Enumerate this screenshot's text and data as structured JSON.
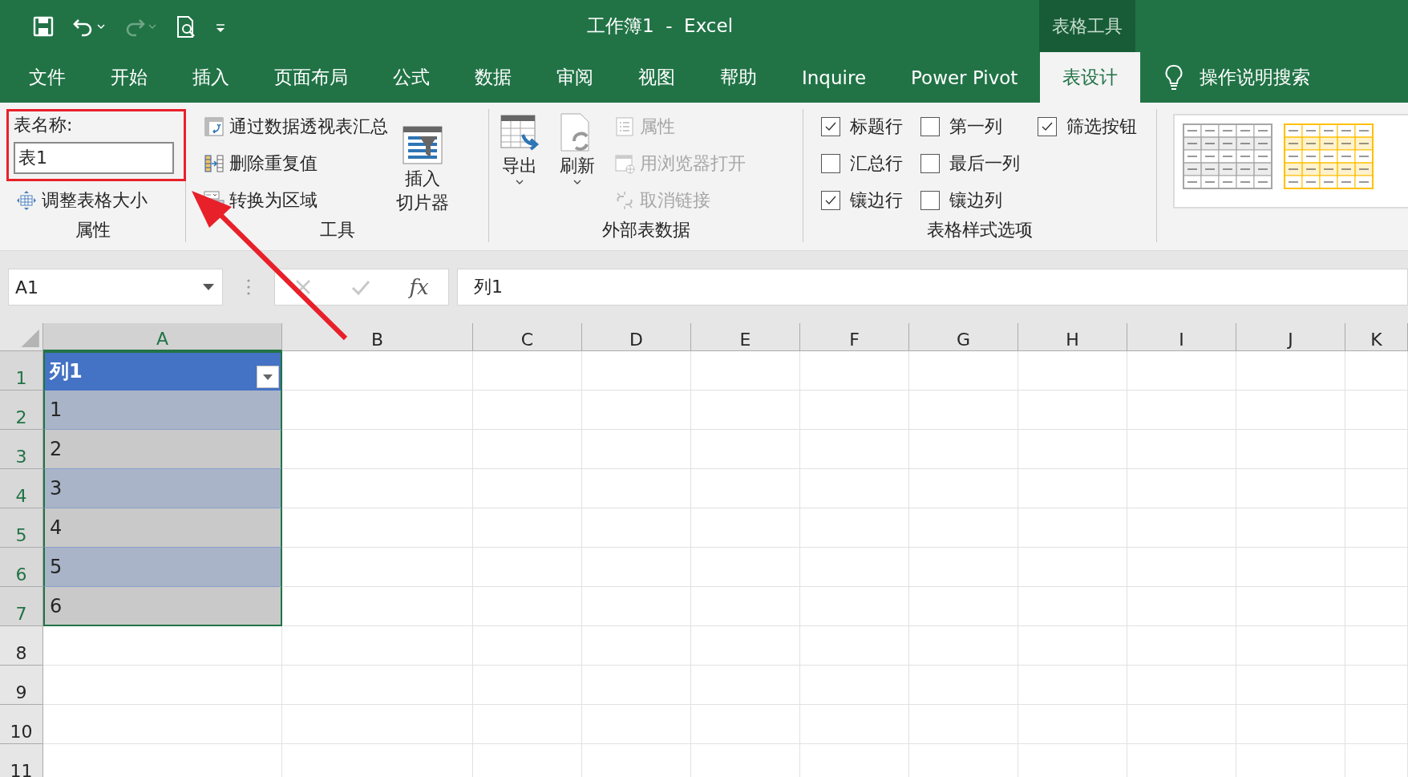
{
  "quick_access": [
    {
      "kind": "save",
      "disabled": false
    },
    {
      "kind": "undo",
      "disabled": false
    },
    {
      "kind": "redo",
      "disabled": true
    },
    {
      "kind": "preview",
      "disabled": false
    },
    {
      "kind": "customize",
      "disabled": false
    }
  ],
  "window": {
    "title": "工作簿1  -  Excel",
    "context_group": "表格工具"
  },
  "ribbon_tabs": [
    {
      "label": "文件",
      "selected": false
    },
    {
      "label": "开始",
      "selected": false
    },
    {
      "label": "插入",
      "selected": false
    },
    {
      "label": "页面布局",
      "selected": false
    },
    {
      "label": "公式",
      "selected": false
    },
    {
      "label": "数据",
      "selected": false
    },
    {
      "label": "审阅",
      "selected": false
    },
    {
      "label": "视图",
      "selected": false
    },
    {
      "label": "帮助",
      "selected": false
    },
    {
      "label": "Inquire",
      "selected": false
    },
    {
      "label": "Power Pivot",
      "selected": false
    },
    {
      "label": "表设计",
      "selected": true
    }
  ],
  "tell_me": "操作说明搜索",
  "properties_group": {
    "label": "属性",
    "name_label": "表名称:",
    "table_name": "表1",
    "resize": "调整表格大小",
    "highlighted": true
  },
  "tools_group": {
    "label": "工具",
    "items": [
      {
        "kind": "pivot",
        "label": "通过数据透视表汇总"
      },
      {
        "kind": "dedupe",
        "label": "删除重复值"
      },
      {
        "kind": "convert",
        "label": "转换为区域"
      }
    ],
    "slicer": [
      "插入",
      "切片器"
    ]
  },
  "external_group": {
    "label": "外部表数据",
    "large": [
      {
        "kind": "export",
        "label": "导出",
        "disabled": false
      },
      {
        "kind": "refresh",
        "label": "刷新",
        "disabled": false
      }
    ],
    "small": [
      {
        "kind": "props",
        "label": "属性",
        "disabled": true
      },
      {
        "kind": "browser",
        "label": "用浏览器打开",
        "disabled": true
      },
      {
        "kind": "unlink",
        "label": "取消链接",
        "disabled": true
      }
    ]
  },
  "style_options_group": {
    "label": "表格样式选项",
    "options": [
      {
        "label": "标题行",
        "checked": true
      },
      {
        "label": "汇总行",
        "checked": false
      },
      {
        "label": "镶边行",
        "checked": true
      },
      {
        "label": "第一列",
        "checked": false
      },
      {
        "label": "最后一列",
        "checked": false
      },
      {
        "label": "镶边列",
        "checked": false
      },
      {
        "label": "筛选按钮",
        "checked": true
      }
    ]
  },
  "table_styles": [
    {
      "color": "#a6a6a6",
      "selected": false
    },
    {
      "color": "#ffc000",
      "selected": false
    }
  ],
  "formula_bar": {
    "name_box": "A1",
    "function_label": "fx",
    "formula": "列1"
  },
  "sheet": {
    "columns": [
      {
        "label": "A",
        "selected": true
      },
      {
        "label": "B",
        "selected": false
      },
      {
        "label": "C",
        "selected": false
      },
      {
        "label": "D",
        "selected": false
      },
      {
        "label": "E",
        "selected": false
      },
      {
        "label": "F",
        "selected": false
      },
      {
        "label": "G",
        "selected": false
      },
      {
        "label": "H",
        "selected": false
      },
      {
        "label": "I",
        "selected": false
      },
      {
        "label": "J",
        "selected": false
      },
      {
        "label": "K",
        "selected": false
      }
    ],
    "rows": [
      {
        "label": "1",
        "selected": true
      },
      {
        "label": "2",
        "selected": true
      },
      {
        "label": "3",
        "selected": true
      },
      {
        "label": "4",
        "selected": true
      },
      {
        "label": "5",
        "selected": true
      },
      {
        "label": "6",
        "selected": true
      },
      {
        "label": "7",
        "selected": true
      },
      {
        "label": "8",
        "selected": false
      },
      {
        "label": "9",
        "selected": false
      },
      {
        "label": "10",
        "selected": false
      },
      {
        "label": "11",
        "selected": false
      }
    ],
    "table": {
      "header": "列1",
      "values": [
        "1",
        "2",
        "3",
        "4",
        "5",
        "6"
      ],
      "banded_rows": true,
      "filter_button": true
    }
  }
}
